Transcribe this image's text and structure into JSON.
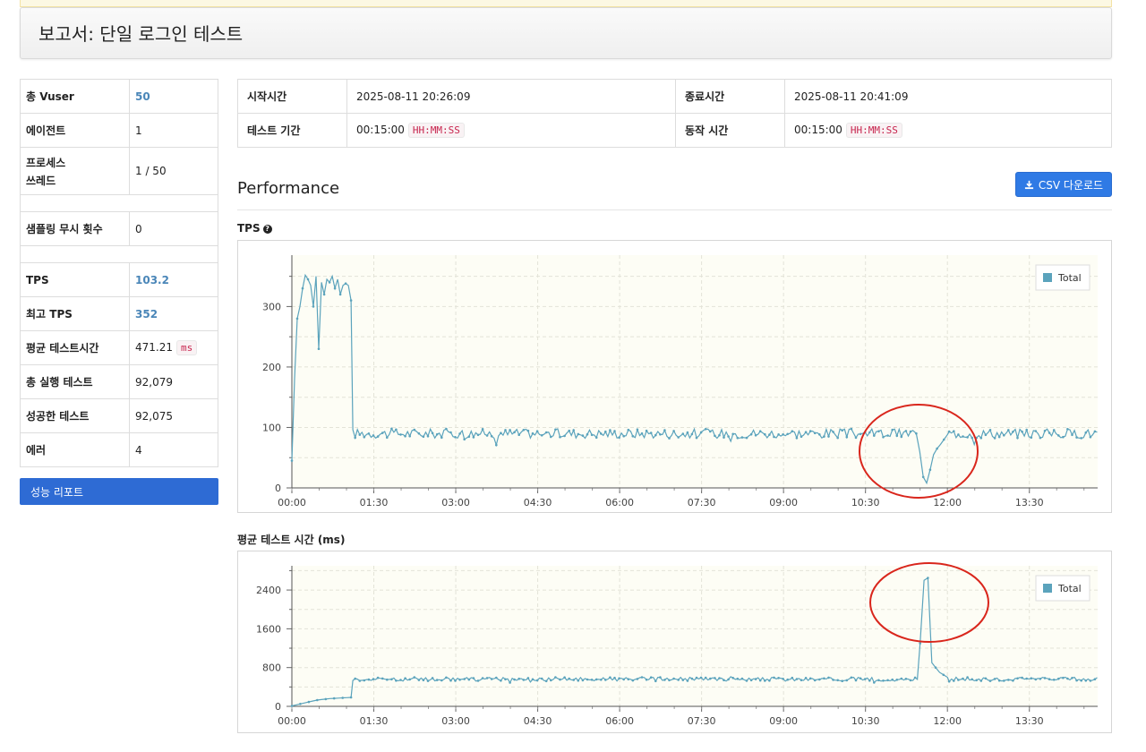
{
  "page": {
    "title": "보고서: 단일 로그인 테스트"
  },
  "summary": [
    {
      "key": "총 Vuser",
      "value": "50",
      "highlight": true
    },
    {
      "key": "에이전트",
      "value": "1"
    },
    {
      "key": "프로세스",
      "key2": "쓰레드",
      "value": "1 / 50"
    },
    {
      "key": "샘플링 무시 횟수",
      "value": "0"
    },
    {
      "key": "TPS",
      "value": "103.2",
      "highlight": true
    },
    {
      "key": "최고 TPS",
      "value": "352",
      "highlight": true
    },
    {
      "key": "평균 테스트시간",
      "value": "471.21",
      "unit": "ms"
    },
    {
      "key": "총 실행 테스트",
      "value": "92,079"
    },
    {
      "key": "성공한 테스트",
      "value": "92,075"
    },
    {
      "key": "에러",
      "value": "4"
    }
  ],
  "report_button": "성능 리포트",
  "time_info": {
    "start_label": "시작시간",
    "start_value": "2025-08-11 20:26:09",
    "end_label": "종료시간",
    "end_value": "2025-08-11 20:41:09",
    "duration_label": "테스트 기간",
    "duration_value": "00:15:00",
    "run_label": "동작 시간",
    "run_value": "00:15:00",
    "format": "HH:MM:SS"
  },
  "performance": {
    "title": "Performance",
    "csv_button": "CSV 다운로드",
    "csv_icon": "download-icon"
  },
  "colors": {
    "series": "#5ba3bc",
    "plot_bg": "#fdfdf5",
    "annotation": "#d9261c",
    "button": "#2f7ae5"
  },
  "chart_data": [
    {
      "type": "line",
      "title": "TPS",
      "help_icon": "question-circle-icon",
      "legend": "top-right",
      "grid": true,
      "xlabel": "",
      "ylabel": "",
      "xlim_seconds": [
        0,
        885
      ],
      "ylim": [
        0,
        385
      ],
      "yticks": [
        0,
        100,
        200,
        300
      ],
      "xtick_labels": [
        "00:00",
        "01:30",
        "03:00",
        "04:30",
        "06:00",
        "07:30",
        "09:00",
        "10:30",
        "12:00",
        "13:30"
      ],
      "series": [
        {
          "name": "Total",
          "phases": [
            {
              "from_seconds": 0,
              "to_seconds": 65,
              "values": [
                45,
                180,
                280,
                300,
                330,
                352,
                345,
                335,
                300,
                350,
                230,
                340,
                320,
                345,
                340,
                350,
                330,
                345,
                320,
                335,
                338,
                335,
                310
              ]
            },
            {
              "from_seconds": 67,
              "to_seconds": 680,
              "steady": 90
            },
            {
              "from_seconds": 682,
              "to_seconds": 720,
              "values": [
                95,
                90,
                60,
                18,
                8,
                30,
                55,
                65,
                72,
                80,
                88
              ]
            },
            {
              "from_seconds": 722,
              "to_seconds": 885,
              "steady": 90
            }
          ]
        }
      ],
      "annotation": {
        "shape": "ellipse",
        "note_range_seconds": [
          635,
          760
        ]
      }
    },
    {
      "type": "line",
      "title": "평균 테스트 시간 (ms)",
      "legend": "top-right",
      "grid": true,
      "xlabel": "",
      "ylabel": "",
      "xlim_seconds": [
        0,
        885
      ],
      "ylim": [
        0,
        2900
      ],
      "yticks": [
        0,
        800,
        1600,
        2400
      ],
      "xtick_labels": [
        "00:00",
        "01:30",
        "03:00",
        "04:30",
        "06:00",
        "07:30",
        "09:00",
        "10:30",
        "12:00",
        "13:30"
      ],
      "series": [
        {
          "name": "Total",
          "phases": [
            {
              "from_seconds": 0,
              "to_seconds": 65,
              "values": [
                10,
                30,
                50,
                70,
                90,
                110,
                130,
                140,
                150,
                160,
                165,
                170,
                175,
                180,
                185
              ]
            },
            {
              "from_seconds": 67,
              "to_seconds": 688,
              "steady": 560
            },
            {
              "from_seconds": 690,
              "to_seconds": 720,
              "values": [
                1300,
                2600,
                2650,
                900,
                800,
                700,
                650,
                600
              ]
            },
            {
              "from_seconds": 722,
              "to_seconds": 885,
              "steady": 560
            }
          ]
        }
      ],
      "annotation": {
        "shape": "ellipse",
        "note_range_seconds": [
          640,
          765
        ]
      }
    }
  ]
}
